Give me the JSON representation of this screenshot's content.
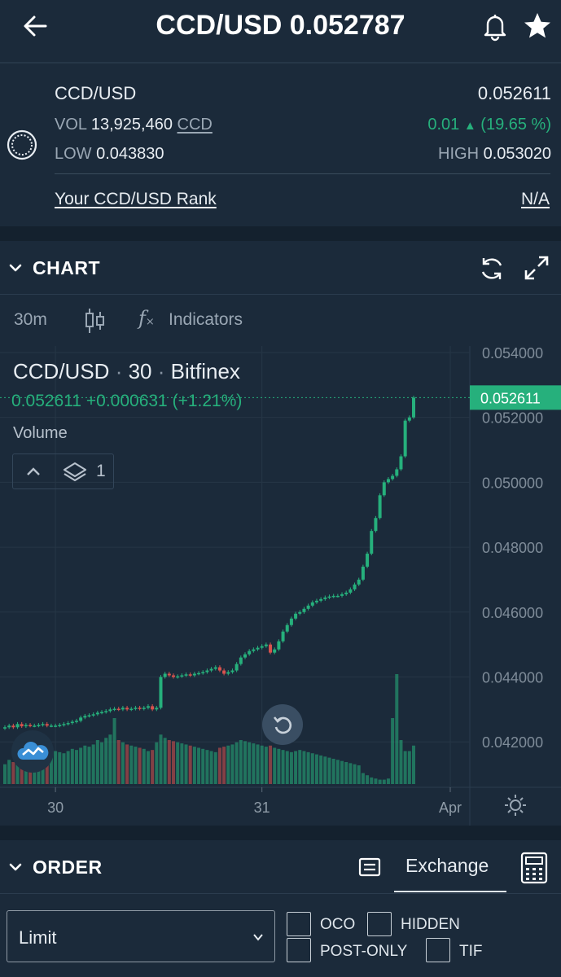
{
  "header": {
    "title": "CCD/USD 0.052787",
    "back_icon": "arrow-left-icon",
    "bell_icon": "bell-icon",
    "star_icon": "star-icon"
  },
  "ticker": {
    "pair": "CCD/USD",
    "last_price": "0.052611",
    "vol_label": "VOL",
    "vol_value": "13,925,460",
    "vol_unit": "CCD",
    "change": "0.01",
    "change_pct": "(19.65 %)",
    "low_label": "LOW",
    "low_value": "0.043830",
    "high_label": "HIGH",
    "high_value": "0.053020",
    "rank_label": "Your CCD/USD Rank",
    "rank_value": "N/A",
    "up_color": "#26b07c",
    "down_color": "#d9524e"
  },
  "chart_section": {
    "title": "CHART",
    "interval": "30m",
    "indicators_label": "Indicators",
    "legend_pair": "CCD/USD",
    "legend_interval": "30",
    "legend_exchange": "Bitfinex",
    "legend_sep": "·",
    "legend_price": "0.052611",
    "legend_change": "+0.000631",
    "legend_change_pct": "(+1.21%)",
    "volume_label": "Volume",
    "volume_count": "1",
    "current_price_tag": "0.052611"
  },
  "chart_data": {
    "type": "candlestick",
    "y_ticks": [
      "0.054000",
      "0.052000",
      "0.050000",
      "0.048000",
      "0.046000",
      "0.044000",
      "0.042000"
    ],
    "x_ticks": [
      "30",
      "31",
      "Apr"
    ],
    "ylim": [
      0.0406,
      0.0542
    ],
    "close_values": [
      0.04245,
      0.0425,
      0.04245,
      0.04255,
      0.04248,
      0.04252,
      0.0425,
      0.0425,
      0.04252,
      0.04255,
      0.0425,
      0.0425,
      0.0425,
      0.04252,
      0.04255,
      0.04258,
      0.04262,
      0.04265,
      0.04275,
      0.0428,
      0.04282,
      0.04285,
      0.0429,
      0.04292,
      0.04295,
      0.043,
      0.04302,
      0.043,
      0.04305,
      0.043,
      0.04302,
      0.04305,
      0.04302,
      0.04305,
      0.0431,
      0.043,
      0.04305,
      0.044,
      0.0441,
      0.04405,
      0.044,
      0.04402,
      0.04405,
      0.04408,
      0.04405,
      0.0441,
      0.04412,
      0.04415,
      0.0442,
      0.04425,
      0.0443,
      0.0442,
      0.0441,
      0.04415,
      0.0442,
      0.0444,
      0.0446,
      0.0447,
      0.0448,
      0.04485,
      0.0449,
      0.04495,
      0.045,
      0.04475,
      0.04485,
      0.0451,
      0.0454,
      0.0456,
      0.0458,
      0.04595,
      0.046,
      0.0461,
      0.0462,
      0.0463,
      0.04635,
      0.0464,
      0.04645,
      0.04648,
      0.0465,
      0.0465,
      0.04655,
      0.0466,
      0.0467,
      0.04685,
      0.047,
      0.0474,
      0.0478,
      0.0485,
      0.0489,
      0.0496,
      0.05,
      0.0501,
      0.0502,
      0.0504,
      0.0508,
      0.0519,
      0.052,
      0.05261
    ],
    "volume_values": [
      18,
      22,
      20,
      25,
      24,
      22,
      21,
      23,
      24,
      22,
      26,
      28,
      30,
      29,
      28,
      30,
      32,
      31,
      33,
      35,
      34,
      36,
      40,
      38,
      42,
      45,
      60,
      40,
      38,
      36,
      35,
      34,
      33,
      32,
      30,
      31,
      38,
      45,
      42,
      40,
      39,
      38,
      37,
      36,
      35,
      34,
      33,
      32,
      31,
      30,
      29,
      33,
      34,
      35,
      36,
      38,
      40,
      39,
      38,
      37,
      36,
      35,
      34,
      35,
      33,
      32,
      31,
      30,
      29,
      30,
      31,
      30,
      29,
      28,
      27,
      26,
      25,
      24,
      23,
      22,
      21,
      20,
      19,
      18,
      17,
      10,
      8,
      6,
      5,
      4,
      4,
      5,
      60,
      100,
      40,
      30,
      30,
      35,
      25,
      45,
      85,
      20
    ],
    "grid": true,
    "price_line_color": "#26b07c"
  },
  "order_section": {
    "title": "ORDER",
    "exchange_tab": "Exchange",
    "order_type": "Limit",
    "options": {
      "oco": "OCO",
      "hidden": "HIDDEN",
      "post_only": "POST-ONLY",
      "tif": "TIF"
    }
  }
}
